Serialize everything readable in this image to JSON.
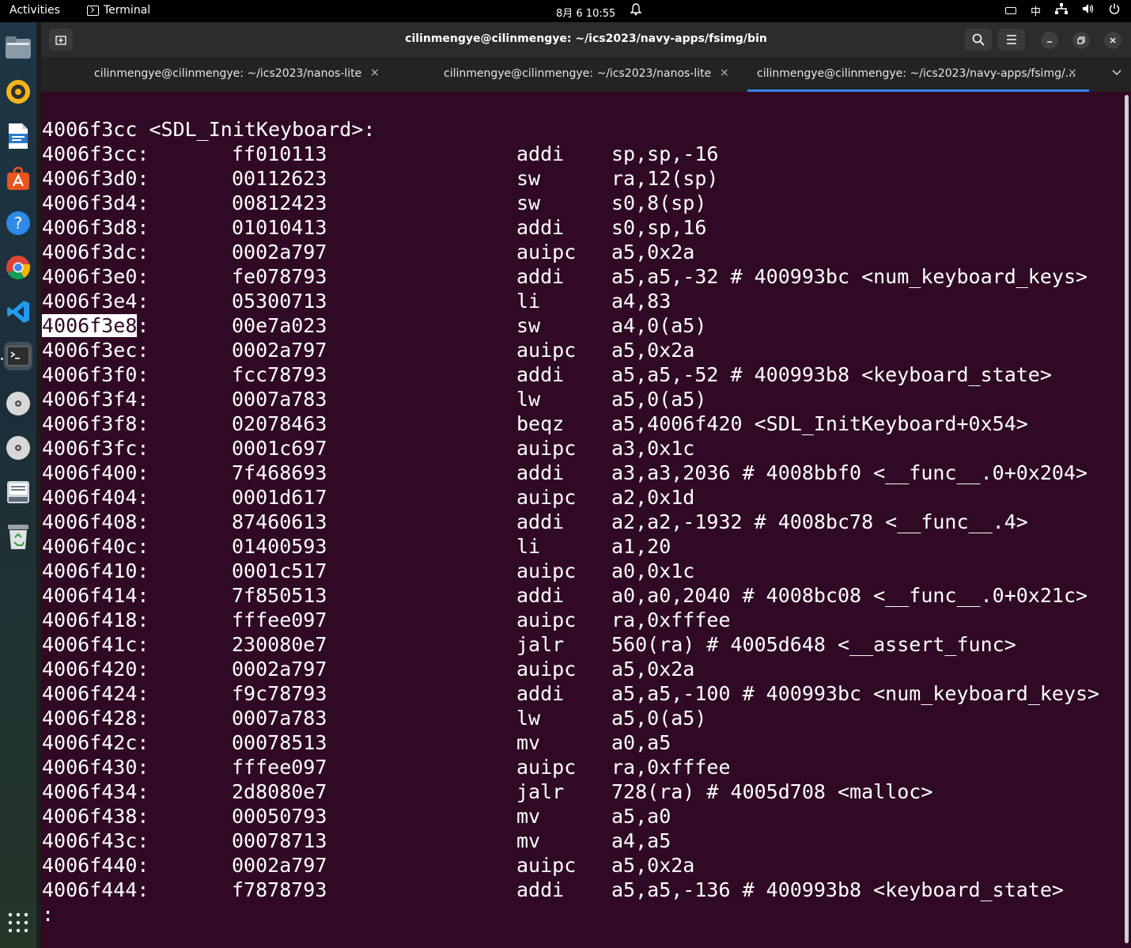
{
  "topbar": {
    "activities": "Activities",
    "app_name": "Terminal",
    "clock": "8月 6  10:55",
    "input_method": "中"
  },
  "dock": {
    "items": [
      "files-icon",
      "rhythmbox-icon",
      "writer-icon",
      "software-icon",
      "help-icon",
      "chrome-icon",
      "vscode-icon",
      "terminal-icon",
      "disc-icon",
      "disc-icon",
      "disk-icon",
      "trash-icon"
    ],
    "show_apps": "apps-grid-icon"
  },
  "window": {
    "title": "cilinmengye@cilinmengye: ~/ics2023/navy-apps/fsimg/bin"
  },
  "tabs": [
    {
      "label": "cilinmengye@cilinmengye: ~/ics2023/nanos-lite",
      "close": "×"
    },
    {
      "label": "cilinmengye@cilinmengye: ~/ics2023/nanos-lite",
      "close": "×"
    },
    {
      "label": "cilinmengye@cilinmengye: ~/ics2023/navy-apps/fsimg/...",
      "close": "×"
    }
  ],
  "terminal": {
    "header": "4006f3cc <SDL_InitKeyboard>:",
    "selected_text": "4006f3e8",
    "lines": [
      {
        "addr": "4006f3cc:",
        "hex": "ff010113",
        "mn": "addi",
        "op": "sp,sp,-16"
      },
      {
        "addr": "4006f3d0:",
        "hex": "00112623",
        "mn": "sw",
        "op": "ra,12(sp)"
      },
      {
        "addr": "4006f3d4:",
        "hex": "00812423",
        "mn": "sw",
        "op": "s0,8(sp)"
      },
      {
        "addr": "4006f3d8:",
        "hex": "01010413",
        "mn": "addi",
        "op": "s0,sp,16"
      },
      {
        "addr": "4006f3dc:",
        "hex": "0002a797",
        "mn": "auipc",
        "op": "a5,0x2a"
      },
      {
        "addr": "4006f3e0:",
        "hex": "fe078793",
        "mn": "addi",
        "op": "a5,a5,-32 # 400993bc <num_keyboard_keys>"
      },
      {
        "addr": "4006f3e4:",
        "hex": "05300713",
        "mn": "li",
        "op": "a4,83"
      },
      {
        "addr": "4006f3e8:",
        "hex": "00e7a023",
        "mn": "sw",
        "op": "a4,0(a5)"
      },
      {
        "addr": "4006f3ec:",
        "hex": "0002a797",
        "mn": "auipc",
        "op": "a5,0x2a"
      },
      {
        "addr": "4006f3f0:",
        "hex": "fcc78793",
        "mn": "addi",
        "op": "a5,a5,-52 # 400993b8 <keyboard_state>"
      },
      {
        "addr": "4006f3f4:",
        "hex": "0007a783",
        "mn": "lw",
        "op": "a5,0(a5)"
      },
      {
        "addr": "4006f3f8:",
        "hex": "02078463",
        "mn": "beqz",
        "op": "a5,4006f420 <SDL_InitKeyboard+0x54>"
      },
      {
        "addr": "4006f3fc:",
        "hex": "0001c697",
        "mn": "auipc",
        "op": "a3,0x1c"
      },
      {
        "addr": "4006f400:",
        "hex": "7f468693",
        "mn": "addi",
        "op": "a3,a3,2036 # 4008bbf0 <__func__.0+0x204>"
      },
      {
        "addr": "4006f404:",
        "hex": "0001d617",
        "mn": "auipc",
        "op": "a2,0x1d"
      },
      {
        "addr": "4006f408:",
        "hex": "87460613",
        "mn": "addi",
        "op": "a2,a2,-1932 # 4008bc78 <__func__.4>"
      },
      {
        "addr": "4006f40c:",
        "hex": "01400593",
        "mn": "li",
        "op": "a1,20"
      },
      {
        "addr": "4006f410:",
        "hex": "0001c517",
        "mn": "auipc",
        "op": "a0,0x1c"
      },
      {
        "addr": "4006f414:",
        "hex": "7f850513",
        "mn": "addi",
        "op": "a0,a0,2040 # 4008bc08 <__func__.0+0x21c>"
      },
      {
        "addr": "4006f418:",
        "hex": "fffee097",
        "mn": "auipc",
        "op": "ra,0xfffee"
      },
      {
        "addr": "4006f41c:",
        "hex": "230080e7",
        "mn": "jalr",
        "op": "560(ra) # 4005d648 <__assert_func>"
      },
      {
        "addr": "4006f420:",
        "hex": "0002a797",
        "mn": "auipc",
        "op": "a5,0x2a"
      },
      {
        "addr": "4006f424:",
        "hex": "f9c78793",
        "mn": "addi",
        "op": "a5,a5,-100 # 400993bc <num_keyboard_keys>"
      },
      {
        "addr": "4006f428:",
        "hex": "0007a783",
        "mn": "lw",
        "op": "a5,0(a5)"
      },
      {
        "addr": "4006f42c:",
        "hex": "00078513",
        "mn": "mv",
        "op": "a0,a5"
      },
      {
        "addr": "4006f430:",
        "hex": "fffee097",
        "mn": "auipc",
        "op": "ra,0xfffee"
      },
      {
        "addr": "4006f434:",
        "hex": "2d8080e7",
        "mn": "jalr",
        "op": "728(ra) # 4005d708 <malloc>"
      },
      {
        "addr": "4006f438:",
        "hex": "00050793",
        "mn": "mv",
        "op": "a5,a0"
      },
      {
        "addr": "4006f43c:",
        "hex": "00078713",
        "mn": "mv",
        "op": "a4,a5"
      },
      {
        "addr": "4006f440:",
        "hex": "0002a797",
        "mn": "auipc",
        "op": "a5,0x2a"
      },
      {
        "addr": "4006f444:",
        "hex": "f7878793",
        "mn": "addi",
        "op": "a5,a5,-136 # 400993b8 <keyboard_state>"
      }
    ],
    "prompt": ":"
  },
  "colors": {
    "terminal_bg": "#300a24",
    "accent": "#3584e4"
  }
}
